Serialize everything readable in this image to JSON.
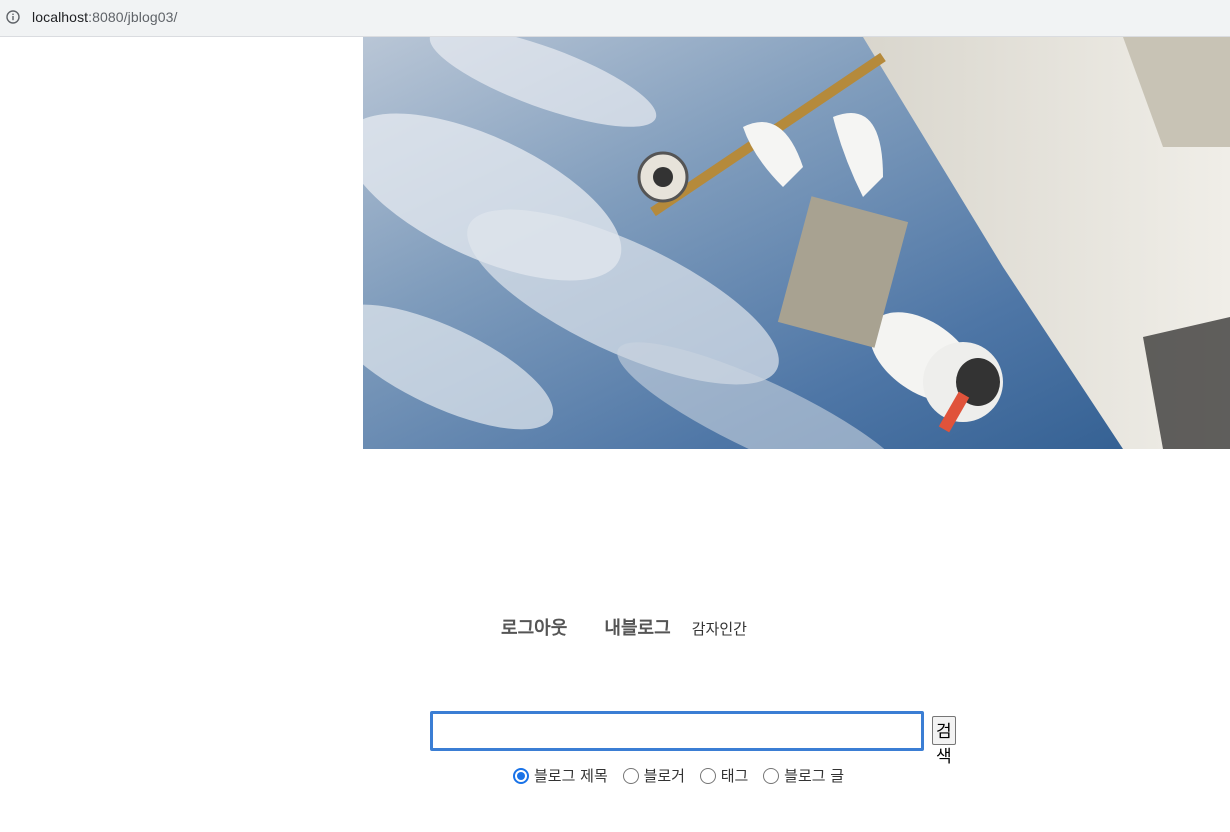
{
  "browser": {
    "url_host": "localhost",
    "url_rest": ":8080/jblog03/",
    "info_icon": "info-circle-icon"
  },
  "banner": {
    "description_icon": "astronaut-spacewalk-image"
  },
  "menu": {
    "logout_label": "로그아웃",
    "myblog_label": "내블로그",
    "username": "감자인간"
  },
  "search": {
    "input_value": "",
    "button_label": "검색",
    "options": [
      {
        "label": "블로그 제목",
        "checked": true
      },
      {
        "label": "블로거",
        "checked": false
      },
      {
        "label": "태그",
        "checked": false
      },
      {
        "label": "블로그 글",
        "checked": false
      }
    ]
  },
  "colors": {
    "focus_border": "#3b7ed4",
    "radio_checked": "#1a73e8"
  }
}
